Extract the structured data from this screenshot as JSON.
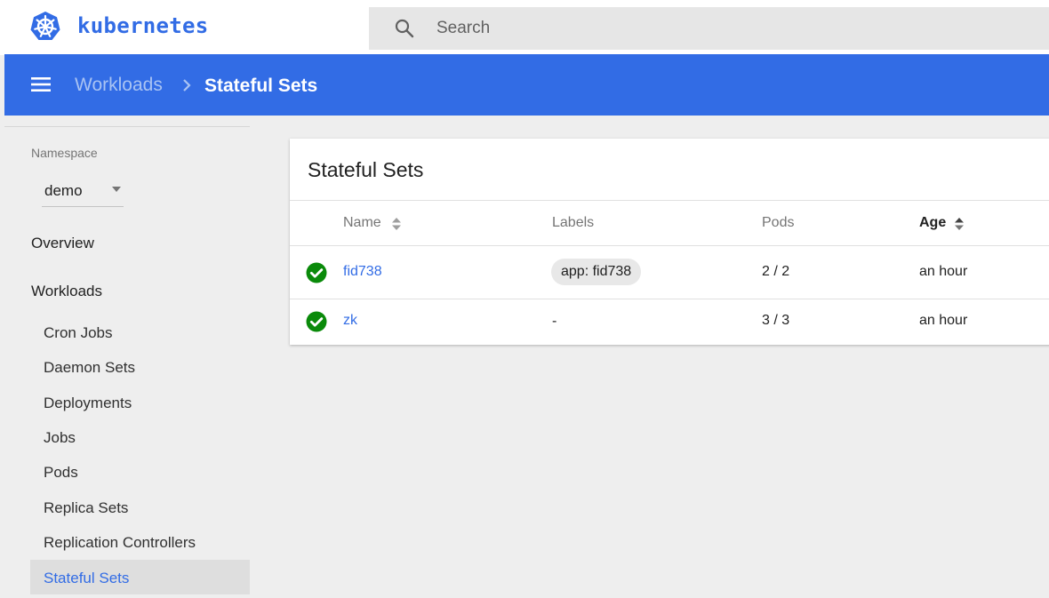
{
  "colors": {
    "brand_blue": "#326ce5",
    "status_ok_green": "#0a8a0a",
    "active_nav_bg": "#dedede"
  },
  "header": {
    "brand": "kubernetes",
    "logo_icon": "kubernetes-helm-icon",
    "search": {
      "placeholder": "Search",
      "icon": "search-icon"
    }
  },
  "breadcrumb": {
    "menu_icon": "menu-icon",
    "parent": "Workloads",
    "separator_icon": "chevron-right-icon",
    "current": "Stateful Sets"
  },
  "sidebar": {
    "namespace_label": "Namespace",
    "namespace_value": "demo",
    "overview": "Overview",
    "workloads": "Workloads",
    "items": [
      {
        "label": "Cron Jobs",
        "active": false
      },
      {
        "label": "Daemon Sets",
        "active": false
      },
      {
        "label": "Deployments",
        "active": false
      },
      {
        "label": "Jobs",
        "active": false
      },
      {
        "label": "Pods",
        "active": false
      },
      {
        "label": "Replica Sets",
        "active": false
      },
      {
        "label": "Replication Controllers",
        "active": false
      },
      {
        "label": "Stateful Sets",
        "active": true
      }
    ]
  },
  "main": {
    "card_title": "Stateful Sets",
    "columns": [
      "Name",
      "Labels",
      "Pods",
      "Age"
    ],
    "sorted_column": "Age",
    "rows": [
      {
        "status": "check-circle-icon",
        "name": "fid738",
        "labels": "app: fid738",
        "pods": "2 / 2",
        "age": "an hour"
      },
      {
        "status": "check-circle-icon",
        "name": "zk",
        "labels": "-",
        "pods": "3 / 3",
        "age": "an hour"
      }
    ]
  }
}
